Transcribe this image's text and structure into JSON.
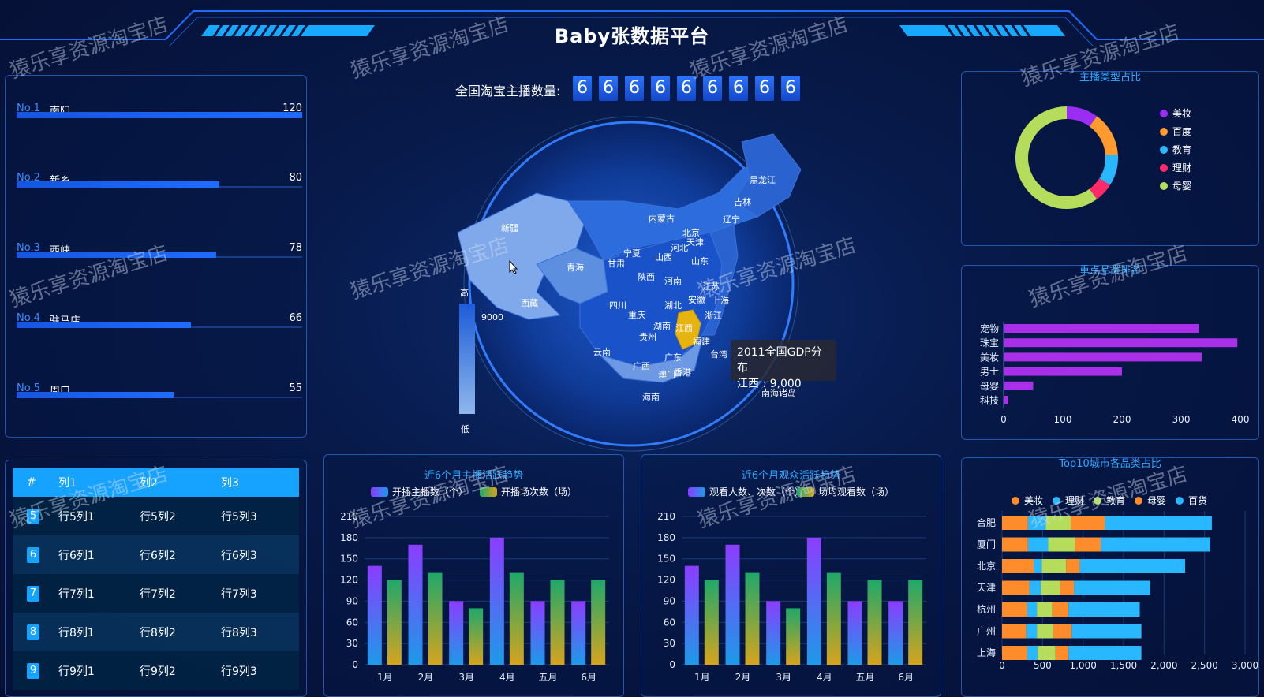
{
  "header": {
    "title": "Baby张数据平台"
  },
  "counter": {
    "label": "全国淘宝主播数量:",
    "hidden_label": "全国淘宝主播数量",
    "digits": [
      "6",
      "6",
      "6",
      "6",
      "6",
      "6",
      "6",
      "6",
      "6"
    ]
  },
  "rank": {
    "items": [
      {
        "no": "No.1",
        "name": "南阳",
        "value": "120",
        "pct": 1.0
      },
      {
        "no": "No.2",
        "name": "新乡",
        "value": "80",
        "pct": 0.71
      },
      {
        "no": "No.3",
        "name": "西峡",
        "value": "78",
        "pct": 0.7
      },
      {
        "no": "No.4",
        "name": "驻马店",
        "value": "66",
        "pct": 0.61
      },
      {
        "no": "No.5",
        "name": "周口",
        "value": "55",
        "pct": 0.55
      }
    ]
  },
  "table": {
    "headers": [
      "#",
      "列1",
      "列2",
      "列3"
    ],
    "rows": [
      [
        "5",
        "行5列1",
        "行5列2",
        "行5列3"
      ],
      [
        "6",
        "行6列1",
        "行6列2",
        "行6列3"
      ],
      [
        "7",
        "行7列1",
        "行7列2",
        "行7列3"
      ],
      [
        "8",
        "行8列1",
        "行8列2",
        "行8列3"
      ],
      [
        "9",
        "行9列1",
        "行9列2",
        "行9列3"
      ]
    ]
  },
  "map": {
    "visualmap_high": "高",
    "visualmap_low": "低",
    "visualmap_value": "9000",
    "tooltip_title": "2011全国GDP分布",
    "tooltip_value": "江西 : 9,000",
    "provinces": [
      "黑龙江",
      "吉林",
      "辽宁",
      "内蒙古",
      "北京",
      "天津",
      "河北",
      "山西",
      "山东",
      "新疆",
      "青海",
      "甘肃",
      "宁夏",
      "陕西",
      "河南",
      "江苏",
      "上海",
      "安徽",
      "湖北",
      "西藏",
      "四川",
      "重庆",
      "浙江",
      "湖南",
      "江西",
      "贵州",
      "福建",
      "云南",
      "广东",
      "广西",
      "台湾",
      "澳门",
      "香港",
      "海南",
      "南海诸岛"
    ]
  },
  "charts": {
    "donut": {
      "title": "主播类型占比",
      "legend": [
        "美妆",
        "百度",
        "教育",
        "理财",
        "母婴"
      ],
      "colors": [
        "#9b2cf2",
        "#ff9a2e",
        "#29b8ff",
        "#ff2a6a",
        "#b5dd5b"
      ]
    },
    "hbar": {
      "title": "重点品类排名"
    },
    "bar1": {
      "title": "近6个月主播活跃趋势",
      "legend": [
        "开播主播数（个）",
        "开播场次数（场）"
      ]
    },
    "bar2": {
      "title": "近6个月观众活跃趋势",
      "legend": [
        "观看人数、次数（个）",
        "场均观看数（场）"
      ]
    },
    "stack": {
      "title": "Top10城市各品类占比",
      "legend": [
        "美妆",
        "理财",
        "教育",
        "母婴",
        "百货"
      ],
      "colors": [
        "#ff8c2a",
        "#29b8ff",
        "#b5dd5b",
        "#ff8c2a",
        "#29b8ff"
      ]
    }
  },
  "chart_data": [
    {
      "type": "pie",
      "title": "主播类型占比",
      "labels": [
        "美妆",
        "百度",
        "教育",
        "理财",
        "母婴"
      ],
      "values": [
        10,
        14,
        10,
        6,
        60
      ]
    },
    {
      "type": "bar",
      "title": "重点品类排名",
      "orientation": "horizontal",
      "categories": [
        "宠物",
        "珠宝",
        "美妆",
        "男士",
        "母婴",
        "科技"
      ],
      "values": [
        330,
        395,
        335,
        200,
        50,
        8
      ],
      "xlim": [
        0,
        400
      ],
      "xticks": [
        "0",
        "100",
        "200",
        "300",
        "400"
      ]
    },
    {
      "type": "bar",
      "title": "近6个月主播活跃趋势",
      "categories": [
        "1月",
        "2月",
        "3月",
        "4月",
        "五月",
        "6月"
      ],
      "series": [
        {
          "name": "开播主播数（个）",
          "values": [
            140,
            170,
            90,
            180,
            90,
            90
          ]
        },
        {
          "name": "开播场次数（场）",
          "values": [
            120,
            130,
            80,
            130,
            120,
            120
          ]
        }
      ],
      "ylim": [
        0,
        210
      ],
      "yticks": [
        "0",
        "30",
        "60",
        "90",
        "120",
        "150",
        "180",
        "210"
      ]
    },
    {
      "type": "bar",
      "title": "近6个月观众活跃趋势",
      "categories": [
        "1月",
        "2月",
        "3月",
        "4月",
        "五月",
        "6月"
      ],
      "series": [
        {
          "name": "观看人数、次数（个）",
          "values": [
            140,
            170,
            90,
            180,
            90,
            90
          ]
        },
        {
          "name": "场均观看数（场）",
          "values": [
            120,
            130,
            80,
            130,
            120,
            120
          ]
        }
      ],
      "ylim": [
        0,
        210
      ],
      "yticks": [
        "0",
        "30",
        "60",
        "90",
        "120",
        "150",
        "180",
        "210"
      ]
    },
    {
      "type": "bar",
      "title": "Top10城市各品类占比",
      "orientation": "horizontal",
      "stacked": true,
      "categories": [
        "合肥",
        "厦门",
        "北京",
        "天津",
        "杭州",
        "广州",
        "上海"
      ],
      "series": [
        {
          "name": "美妆",
          "values": [
            320,
            320,
            390,
            340,
            310,
            300,
            310
          ]
        },
        {
          "name": "理财",
          "values": [
            220,
            250,
            100,
            140,
            120,
            130,
            130
          ]
        },
        {
          "name": "教育",
          "values": [
            310,
            330,
            300,
            240,
            190,
            200,
            220
          ]
        },
        {
          "name": "母婴",
          "values": [
            420,
            320,
            170,
            170,
            200,
            230,
            160
          ]
        },
        {
          "name": "百货",
          "values": [
            1320,
            1350,
            1300,
            940,
            880,
            860,
            900
          ]
        }
      ],
      "xlim": [
        0,
        3000
      ],
      "xticks": [
        "0",
        "500",
        "1,000",
        "1,500",
        "2,000",
        "2,500",
        "3,000"
      ]
    }
  ],
  "watermark": "猿乐享资源淘宝店"
}
